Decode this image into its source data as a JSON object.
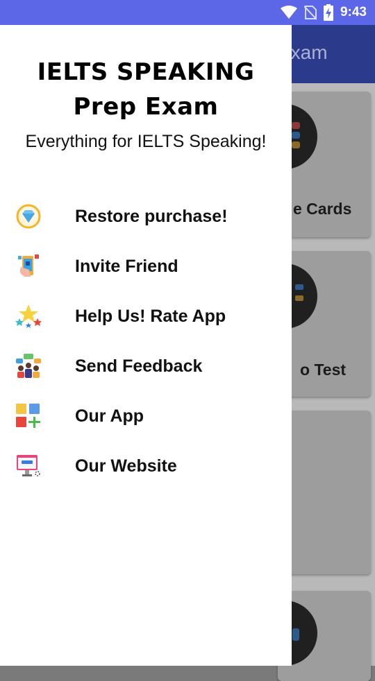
{
  "status_bar": {
    "time": "9:43"
  },
  "app_behind": {
    "title_fragment": "Exam",
    "card_labels": [
      "e Cards",
      "o Test"
    ]
  },
  "drawer": {
    "title_line1": "IELTS SPEAKING",
    "title_line2": "Prep Exam",
    "subtitle": "Everything for IELTS Speaking!",
    "items": [
      {
        "label": "Restore purchase!",
        "icon": "diamond-icon"
      },
      {
        "label": "Invite Friend",
        "icon": "invite-phone-icon"
      },
      {
        "label": "Help Us! Rate App",
        "icon": "stars-icon"
      },
      {
        "label": "Send Feedback",
        "icon": "feedback-people-icon"
      },
      {
        "label": "Our App",
        "icon": "apps-grid-icon"
      },
      {
        "label": "Our Website",
        "icon": "website-icon"
      }
    ]
  },
  "colors": {
    "status_bar": "#5b67e6",
    "toolbar": "#2c3a8c",
    "drawer_bg": "#ffffff"
  }
}
